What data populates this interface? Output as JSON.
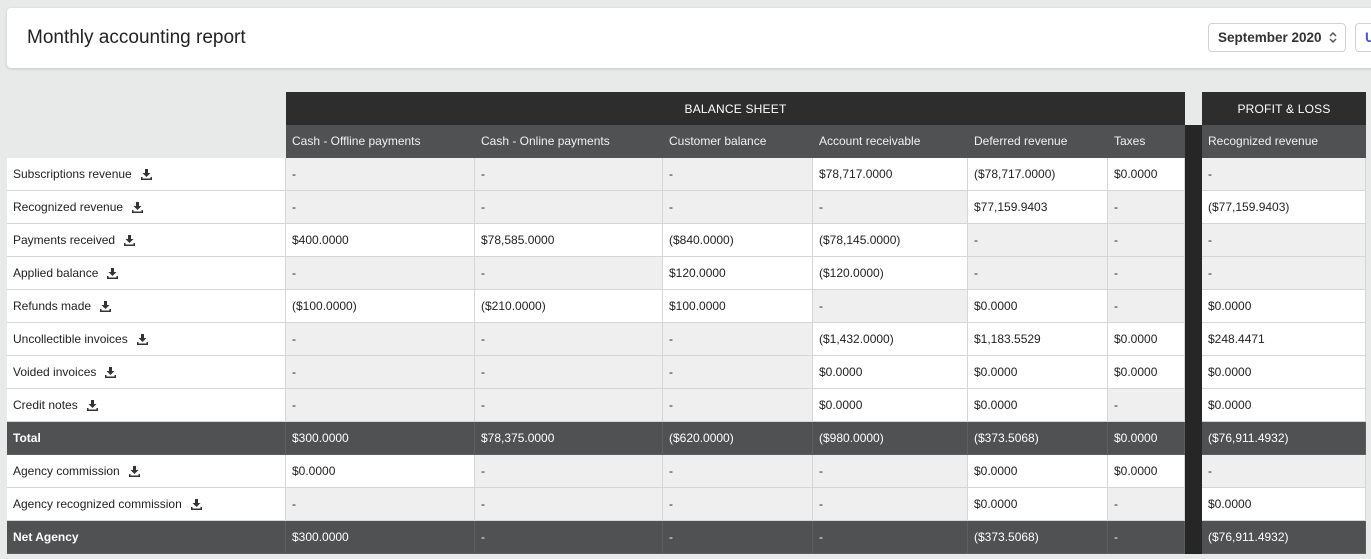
{
  "header": {
    "title": "Monthly accounting report",
    "month_selected": "September 2020",
    "next_label": "U"
  },
  "sections": {
    "balance_sheet": "BALANCE SHEET",
    "profit_loss": "PROFIT & LOSS"
  },
  "columns": [
    "Cash - Offline payments",
    "Cash - Online payments",
    "Customer balance",
    "Account receivable",
    "Deferred revenue",
    "Taxes",
    "Recognized revenue"
  ],
  "rows": [
    {
      "label": "Subscriptions revenue",
      "download": true,
      "kind": "normal",
      "values": [
        "-",
        "-",
        "-",
        "$78,717.0000",
        "($78,717.0000)",
        "$0.0000",
        "-"
      ]
    },
    {
      "label": "Recognized revenue",
      "download": true,
      "kind": "normal",
      "values": [
        "-",
        "-",
        "-",
        "-",
        "$77,159.9403",
        "-",
        "($77,159.9403)"
      ]
    },
    {
      "label": "Payments received",
      "download": true,
      "kind": "normal",
      "values": [
        "$400.0000",
        "$78,585.0000",
        "($840.0000)",
        "($78,145.0000)",
        "-",
        "-",
        "-"
      ]
    },
    {
      "label": "Applied balance",
      "download": true,
      "kind": "normal",
      "values": [
        "-",
        "-",
        "$120.0000",
        "($120.0000)",
        "-",
        "-",
        "-"
      ]
    },
    {
      "label": "Refunds made",
      "download": true,
      "kind": "normal",
      "values": [
        "($100.0000)",
        "($210.0000)",
        "$100.0000",
        "-",
        "$0.0000",
        "-",
        "$0.0000"
      ]
    },
    {
      "label": "Uncollectible invoices",
      "download": true,
      "kind": "normal",
      "values": [
        "-",
        "-",
        "-",
        "($1,432.0000)",
        "$1,183.5529",
        "$0.0000",
        "$248.4471"
      ]
    },
    {
      "label": "Voided invoices",
      "download": true,
      "kind": "normal",
      "values": [
        "-",
        "-",
        "-",
        "$0.0000",
        "$0.0000",
        "$0.0000",
        "$0.0000"
      ]
    },
    {
      "label": "Credit notes",
      "download": true,
      "kind": "normal",
      "values": [
        "-",
        "-",
        "-",
        "$0.0000",
        "$0.0000",
        "-",
        "$0.0000"
      ]
    },
    {
      "label": "Total",
      "download": false,
      "kind": "total",
      "values": [
        "$300.0000",
        "$78,375.0000",
        "($620.0000)",
        "($980.0000)",
        "($373.5068)",
        "$0.0000",
        "($76,911.4932)"
      ]
    },
    {
      "label": "Agency commission",
      "download": true,
      "kind": "normal",
      "values": [
        "$0.0000",
        "-",
        "-",
        "-",
        "$0.0000",
        "$0.0000",
        "-"
      ]
    },
    {
      "label": "Agency recognized commission",
      "download": true,
      "kind": "normal",
      "values": [
        "-",
        "-",
        "-",
        "-",
        "$0.0000",
        "-",
        "$0.0000"
      ]
    },
    {
      "label": "Net Agency",
      "download": false,
      "kind": "total",
      "values": [
        "$300.0000",
        "-",
        "-",
        "-",
        "($373.5068)",
        "-",
        "($76,911.4932)"
      ]
    }
  ]
}
